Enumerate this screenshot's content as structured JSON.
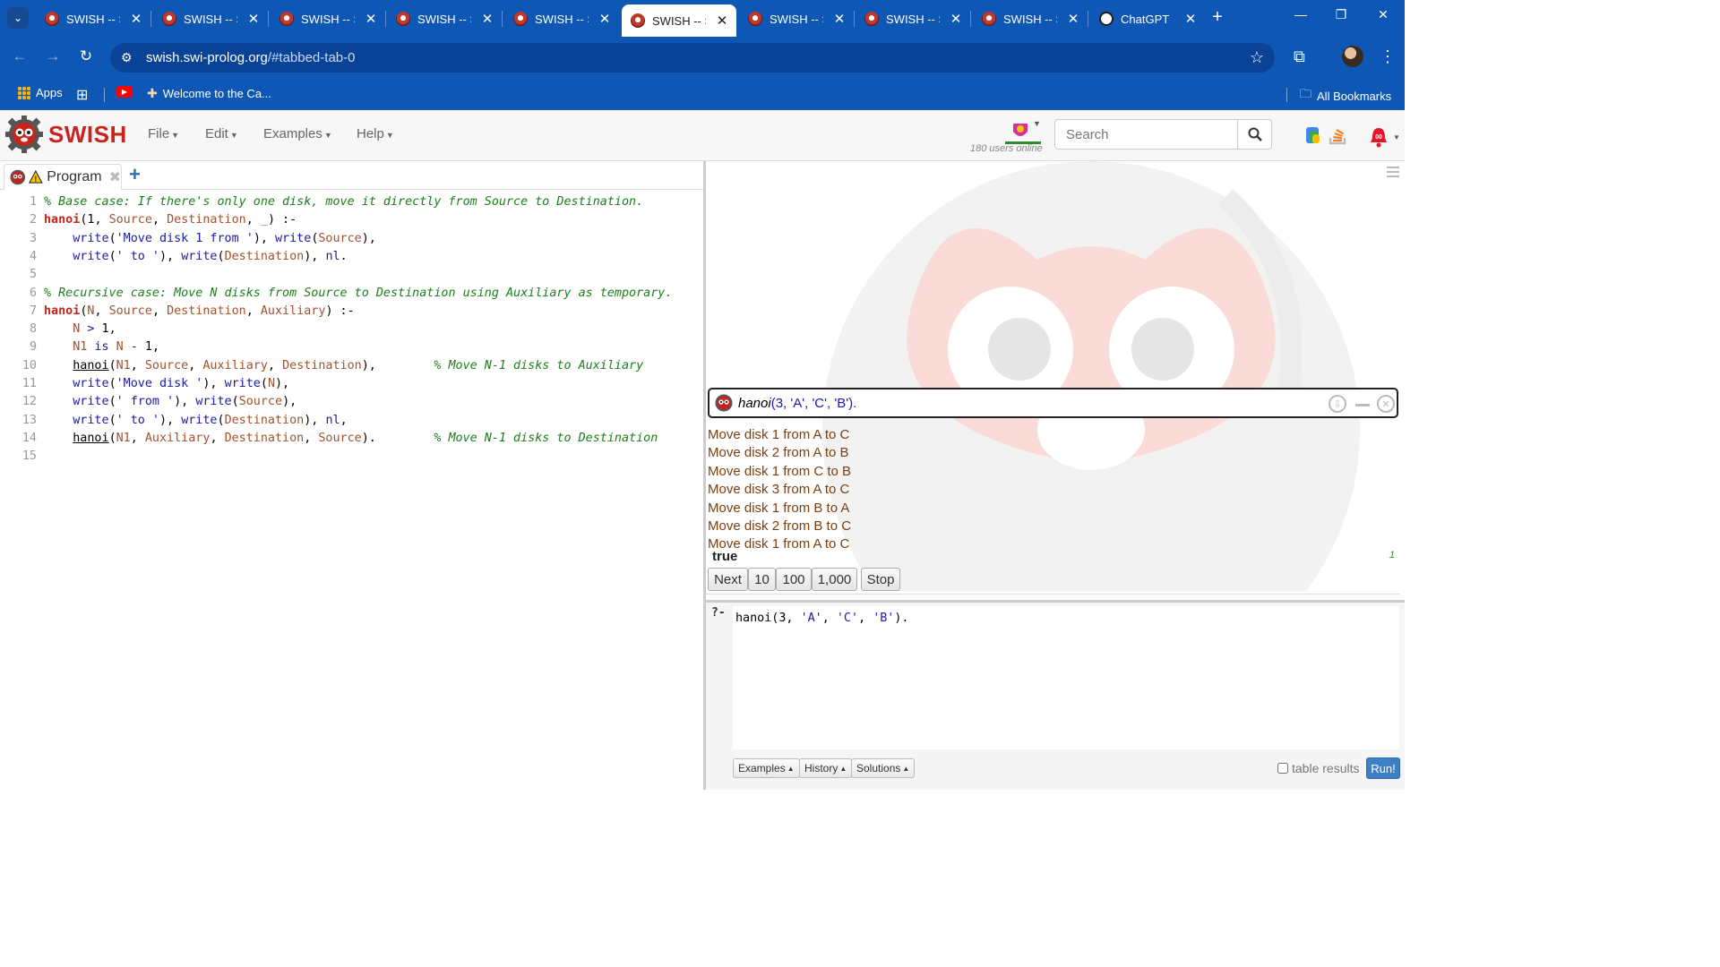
{
  "browser": {
    "tabs": [
      {
        "title": "SWISH -- S",
        "active": false
      },
      {
        "title": "SWISH -- S",
        "active": false
      },
      {
        "title": "SWISH -- S",
        "active": false
      },
      {
        "title": "SWISH -- S",
        "active": false
      },
      {
        "title": "SWISH -- S",
        "active": false
      },
      {
        "title": "SWISH -- S",
        "active": true
      },
      {
        "title": "SWISH -- S",
        "active": false
      },
      {
        "title": "SWISH -- S",
        "active": false
      },
      {
        "title": "SWISH -- S",
        "active": false
      },
      {
        "title": "ChatGPT",
        "active": false
      }
    ],
    "url_host": "swish.swi-prolog.org",
    "url_path": "/#tabbed-tab-0",
    "bookmarks": {
      "apps": "Apps",
      "welcome": "Welcome to the Ca...",
      "all": "All Bookmarks"
    }
  },
  "app": {
    "brand": "SWISH",
    "menus": [
      "File",
      "Edit",
      "Examples",
      "Help"
    ],
    "users_online": "180 users online",
    "search_placeholder": "Search"
  },
  "editor": {
    "tab_label": "Program",
    "lines": [
      "1",
      "2",
      "3",
      "4",
      "5",
      "6",
      "7",
      "8",
      "9",
      "10",
      "11",
      "12",
      "13",
      "14",
      "15"
    ]
  },
  "answer": {
    "query_pred": "hanoi",
    "query_args": "(3, 'A', 'C', 'B').",
    "output": [
      "Move disk 1 from A to C",
      "Move disk 2 from A to B",
      "Move disk 1 from C to B",
      "Move disk 3 from A to C",
      "Move disk 1 from B to A",
      "Move disk 2 from B to C",
      "Move disk 1 from A to C"
    ],
    "result": "true",
    "count": "1",
    "buttons": [
      "Next",
      "10",
      "100",
      "1,000",
      "Stop"
    ]
  },
  "query": {
    "prompt": "?-",
    "text": "hanoi(3, 'A', 'C', 'B').",
    "buttons": [
      "Examples",
      "History",
      "Solutions"
    ],
    "table_results": "table results",
    "run": "Run!"
  },
  "colors": {
    "browser_blue": "#0f57b5",
    "swish_red": "#c7241e",
    "comment_green": "#1a7f1a",
    "output_brown": "#7b3f10",
    "run_blue": "#3f7fc4"
  }
}
